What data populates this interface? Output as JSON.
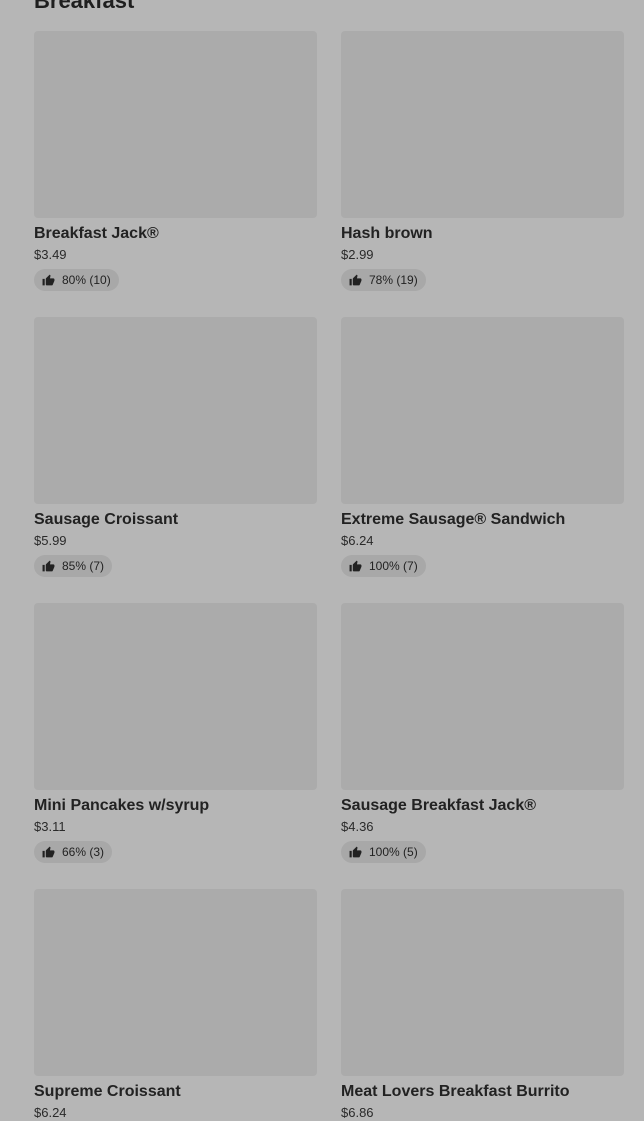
{
  "section": {
    "title": "Breakfast"
  },
  "items": [
    {
      "name": "Breakfast Jack®",
      "price": "$3.49",
      "rating": "80% (10)"
    },
    {
      "name": "Hash brown",
      "price": "$2.99",
      "rating": "78% (19)"
    },
    {
      "name": "Sausage Croissant",
      "price": "$5.99",
      "rating": "85% (7)"
    },
    {
      "name": "Extreme Sausage® Sandwich",
      "price": "$6.24",
      "rating": "100% (7)"
    },
    {
      "name": "Mini Pancakes w/syrup",
      "price": "$3.11",
      "rating": "66% (3)"
    },
    {
      "name": "Sausage Breakfast Jack®",
      "price": "$4.36",
      "rating": "100% (5)"
    },
    {
      "name": "Supreme Croissant",
      "price": "$6.24",
      "rating": ""
    },
    {
      "name": "Meat Lovers Breakfast Burrito",
      "price": "$6.86",
      "rating": ""
    }
  ],
  "icons": {
    "rating": "thumbs-up-icon"
  },
  "colors": {
    "background": "#b6b6b6",
    "image_placeholder": "#ababab",
    "rating_pill": "#a8a8a8",
    "text": "#1f1f1f"
  }
}
